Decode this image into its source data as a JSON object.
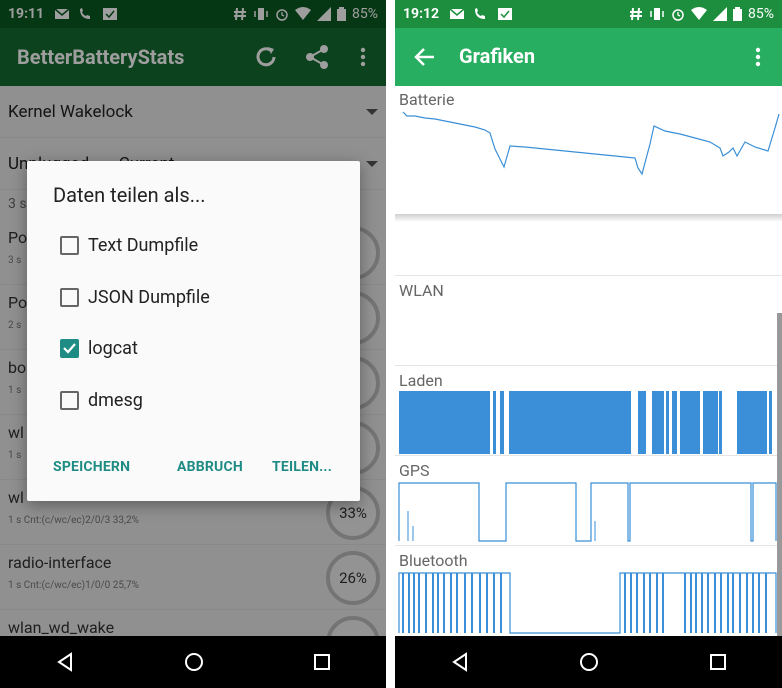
{
  "left": {
    "status": {
      "time": "19:11",
      "battery": "85%"
    },
    "app_title": "BetterBatteryStats",
    "spinner1": "Kernel Wakelock",
    "spinner2": "Unplugged",
    "spinner2_right": "Current",
    "count_text": "3 s",
    "rows": [
      {
        "name": "Po",
        "sub": "3 s",
        "pct": "%"
      },
      {
        "name": "Po",
        "sub": "2 s",
        "pct": "%"
      },
      {
        "name": "bo",
        "sub": "1 s",
        "pct": "%"
      },
      {
        "name": "wl",
        "sub": "1 s",
        "pct": "%"
      },
      {
        "name": "wl",
        "sub": "1 s  Cnt:(c/wc/ec)2/0/3 33,2%",
        "pct": "33%"
      },
      {
        "name": "radio-interface",
        "sub": "1 s  Cnt:(c/wc/ec)1/0/0 25,7%",
        "pct": "26%"
      },
      {
        "name": "wlan_wd_wake",
        "sub": "",
        "pct": ""
      }
    ],
    "dialog": {
      "title": "Daten teilen als...",
      "options": [
        {
          "label": "Text Dumpfile",
          "checked": false
        },
        {
          "label": "JSON Dumpfile",
          "checked": false
        },
        {
          "label": "logcat",
          "checked": true
        },
        {
          "label": "dmesg",
          "checked": false
        }
      ],
      "btn_save": "SPEICHERN",
      "btn_cancel": "ABBRUCH",
      "btn_share": "TEILEN..."
    },
    "colors": {
      "statusbar": "#0b5a23",
      "appbar": "#146b2f",
      "accent": "#1e8c84"
    }
  },
  "right": {
    "status": {
      "time": "19:12",
      "battery": "85%"
    },
    "app_title": "Grafiken",
    "sections": [
      "Batterie",
      "WLAN",
      "Laden",
      "GPS",
      "Bluetooth"
    ],
    "colors": {
      "statusbar": "#1c8e3e",
      "appbar": "#27ae60",
      "chart": "#3a8fd8"
    }
  }
}
